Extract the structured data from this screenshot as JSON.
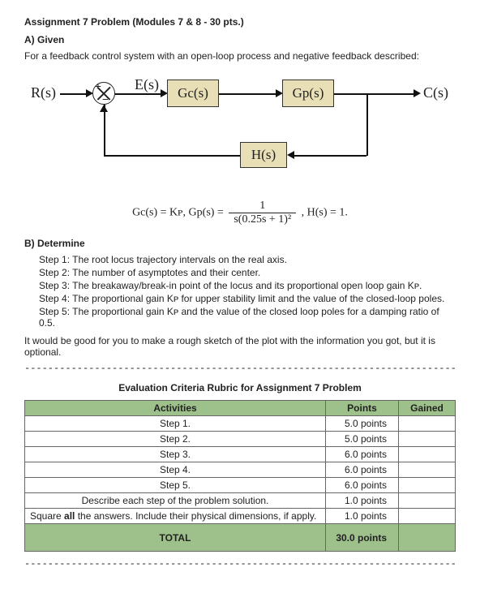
{
  "title": "Assignment 7 Problem (Modules 7 & 8 - 30 pts.)",
  "sectionA": "A) Given",
  "intro": "For a feedback control system with an open-loop process and negative feedback described:",
  "diagram": {
    "R": "R(s)",
    "E": "E(s)",
    "C": "C(s)",
    "Gc": "Gc(s)",
    "Gp": "Gp(s)",
    "H": "H(s)",
    "plus": "+",
    "minus": "−"
  },
  "equation": {
    "left": "Gc(s) = Kᴘ,  Gp(s) = ",
    "num": "1",
    "den": "s(0.25s + 1)²",
    "right": ",  H(s) = 1."
  },
  "sectionB": "B) Determine",
  "steps": [
    "Step 1: The root locus trajectory intervals on the real axis.",
    "Step 2: The number of asymptotes and their center.",
    "Step 3: The breakaway/break-in point of the locus and its proportional open loop gain Kᴘ.",
    "Step 4: The proportional gain Kᴘ for upper stability limit and the value of the closed-loop poles.",
    "Step 5: The proportional gain Kᴘ and the value of the closed loop poles for a damping ratio of 0.5."
  ],
  "note": "It would be good for you to make a rough sketch of the plot with the information you got, but it is optional.",
  "dashline": "--------------------------------------------------------------------------------------------------------------",
  "rubric": {
    "title": "Evaluation Criteria Rubric for Assignment 7 Problem",
    "headers": [
      "Activities",
      "Points",
      "Gained"
    ],
    "rows": [
      {
        "activity": "Step 1.",
        "points": "5.0 points"
      },
      {
        "activity": "Step 2.",
        "points": "5.0 points"
      },
      {
        "activity": "Step 3.",
        "points": "6.0 points"
      },
      {
        "activity": "Step 4.",
        "points": "6.0 points"
      },
      {
        "activity": "Step 5.",
        "points": "6.0 points"
      }
    ],
    "describe_row": {
      "activity": "Describe each step of the problem solution.",
      "points": "1.0 points"
    },
    "square_row_prefix": "Square ",
    "square_row_bold": "all",
    "square_row_suffix": " the answers. Include their physical dimensions, if apply.",
    "square_points": "1.0 points",
    "total_label": "TOTAL",
    "total_points": "30.0 points"
  }
}
